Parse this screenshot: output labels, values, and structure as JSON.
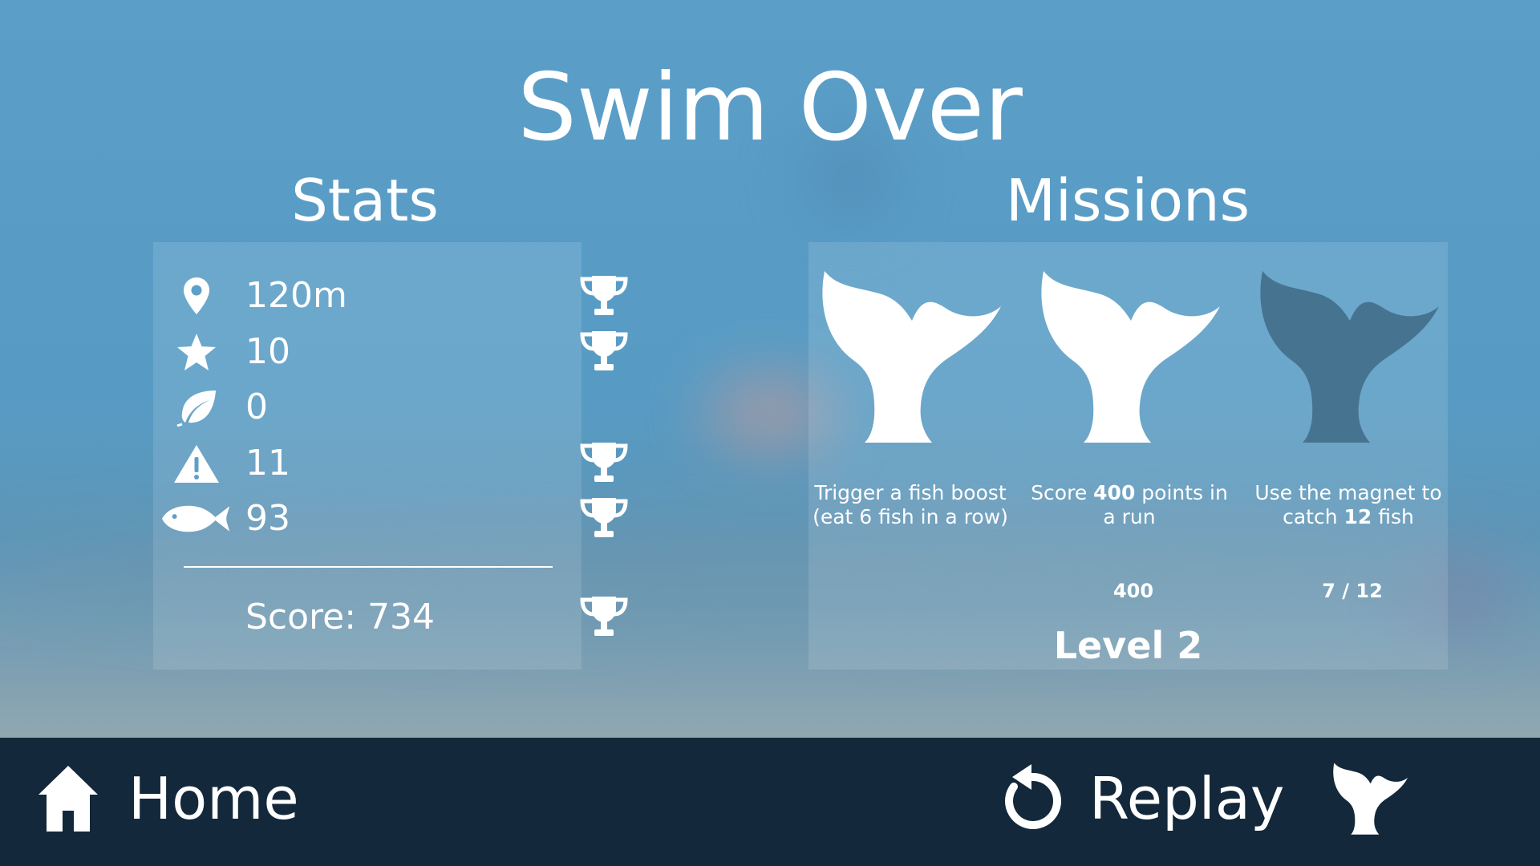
{
  "title": "Swim Over",
  "stats": {
    "heading": "Stats",
    "rows": [
      {
        "icon": "location-pin-icon",
        "value": "120m",
        "trophy": true
      },
      {
        "icon": "star-icon",
        "value": "10",
        "trophy": true
      },
      {
        "icon": "leaf-icon",
        "value": "0",
        "trophy": false
      },
      {
        "icon": "warning-icon",
        "value": "11",
        "trophy": true
      },
      {
        "icon": "fish-icon",
        "value": "93",
        "trophy": true
      }
    ],
    "score_label": "Score: 734"
  },
  "missions": {
    "heading": "Missions",
    "items": [
      {
        "desc_parts": [
          "Trigger a fish boost (eat 6 fish in a row)"
        ],
        "progress": "",
        "completed": true
      },
      {
        "desc_parts": [
          "Score ",
          "400",
          " points in a run"
        ],
        "progress": "400",
        "completed": true
      },
      {
        "desc_parts": [
          "Use the magnet to catch ",
          "12",
          " fish"
        ],
        "progress": "7 / 12",
        "completed": false
      }
    ],
    "level": "Level 2"
  },
  "bottom_bar": {
    "home_label": "Home",
    "replay_label": "Replay"
  },
  "colors": {
    "background": "#5b9fc9",
    "bottom_bar": "#13283a",
    "tail_done": "#ffffff",
    "tail_pending": "#3f6a85"
  }
}
